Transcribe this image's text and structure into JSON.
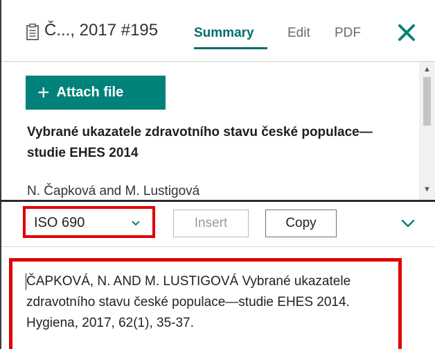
{
  "header": {
    "title": "Č..., 2017 #195",
    "tabs": {
      "summary": "Summary",
      "edit": "Edit",
      "pdf": "PDF"
    },
    "icons": {
      "document": "document-icon",
      "close": "close-icon"
    },
    "accent_color": "#00827a"
  },
  "content": {
    "attach_button_label": "Attach file",
    "document_title": "Vybrané ukazatele zdravotního stavu české populace—studie EHES 2014",
    "authors": "N. Čapková and M. Lustigová"
  },
  "toolbar": {
    "citation_style": "ISO 690",
    "insert_label": "Insert",
    "copy_label": "Copy"
  },
  "citation": {
    "text": "ČAPKOVÁ, N. AND M. LUSTIGOVÁ Vybrané ukazatele zdravotního stavu české populace—studie EHES 2014. Hygiena,  2017, 62(1), 35-37."
  },
  "highlight_color": "#e00000"
}
